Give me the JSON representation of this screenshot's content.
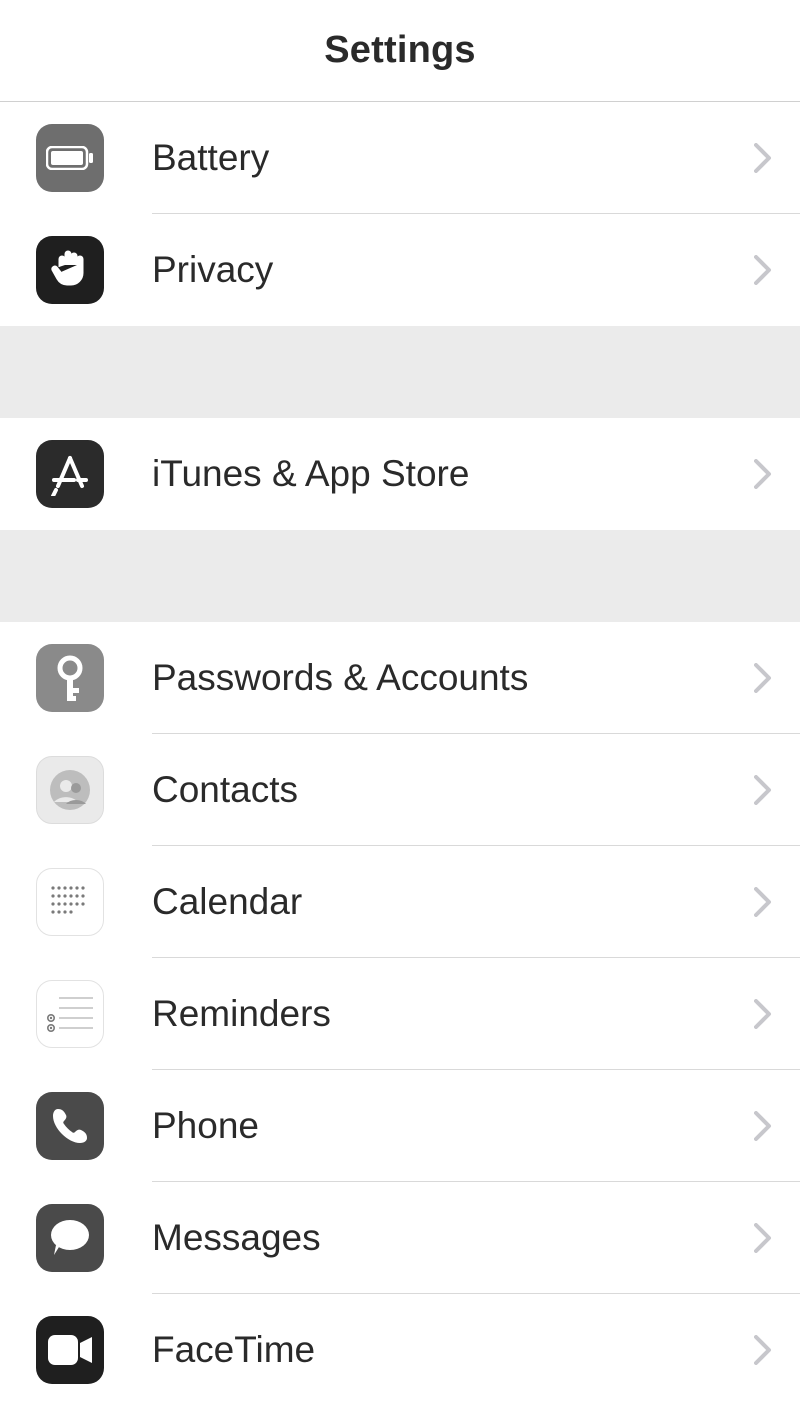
{
  "header": {
    "title": "Settings"
  },
  "groups": [
    {
      "items": [
        {
          "id": "battery",
          "label": "Battery",
          "icon": "battery-icon"
        },
        {
          "id": "privacy",
          "label": "Privacy",
          "icon": "hand-icon"
        }
      ]
    },
    {
      "items": [
        {
          "id": "itunes",
          "label": "iTunes & App Store",
          "icon": "appstore-icon"
        }
      ]
    },
    {
      "items": [
        {
          "id": "passwords",
          "label": "Passwords & Accounts",
          "icon": "key-icon"
        },
        {
          "id": "contacts",
          "label": "Contacts",
          "icon": "contacts-icon"
        },
        {
          "id": "calendar",
          "label": "Calendar",
          "icon": "calendar-icon"
        },
        {
          "id": "reminders",
          "label": "Reminders",
          "icon": "reminders-icon"
        },
        {
          "id": "phone",
          "label": "Phone",
          "icon": "phone-icon"
        },
        {
          "id": "messages",
          "label": "Messages",
          "icon": "messages-icon"
        },
        {
          "id": "facetime",
          "label": "FaceTime",
          "icon": "facetime-icon"
        }
      ]
    }
  ]
}
